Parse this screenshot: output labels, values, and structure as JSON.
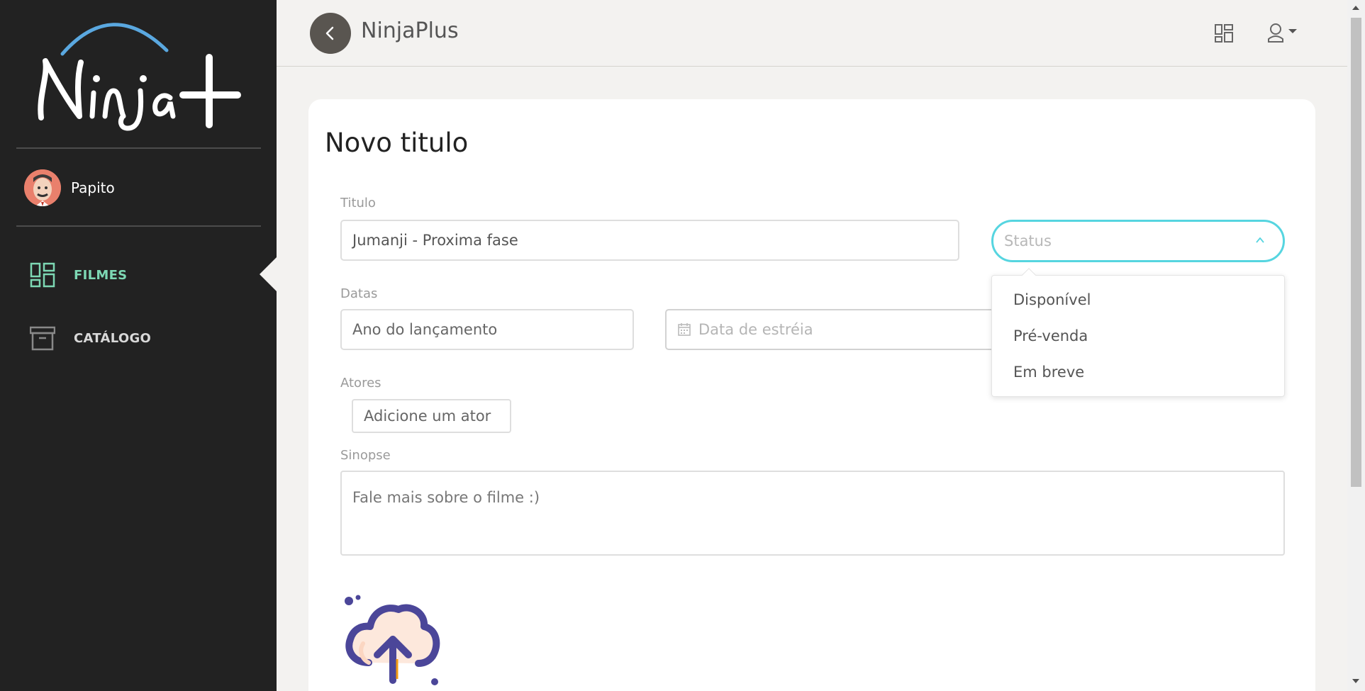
{
  "sidebar": {
    "logo_text": "Ninja+",
    "user": {
      "name": "Papito"
    },
    "items": [
      {
        "label": "FILMES",
        "icon": "dashboard-icon",
        "active": true
      },
      {
        "label": "CATÁLOGO",
        "icon": "archive-box-icon",
        "active": false
      }
    ]
  },
  "header": {
    "title": "NinjaPlus",
    "back_icon": "chevron-left-icon",
    "grid_icon": "dashboard-icon",
    "user_icon": "user-icon"
  },
  "form": {
    "title": "Novo titulo",
    "titulo": {
      "label": "Titulo",
      "value": "Jumanji - Proxima fase"
    },
    "status": {
      "placeholder": "Status",
      "options": [
        "Disponível",
        "Pré-venda",
        "Em breve"
      ],
      "open": true
    },
    "datas": {
      "label": "Datas",
      "ano_placeholder": "Ano do lançamento",
      "estreia_placeholder": "Data de estréia"
    },
    "atores": {
      "label": "Atores",
      "placeholder": "Adicione um ator"
    },
    "sinopse": {
      "label": "Sinopse",
      "placeholder": "Fale mais sobre o filme :)"
    },
    "upload_icon": "cloud-upload-icon"
  },
  "colors": {
    "sidebar_bg": "#222222",
    "accent_green": "#7dd8b4",
    "accent_cyan": "#56d5e0",
    "upload_purple": "#4b4699"
  }
}
